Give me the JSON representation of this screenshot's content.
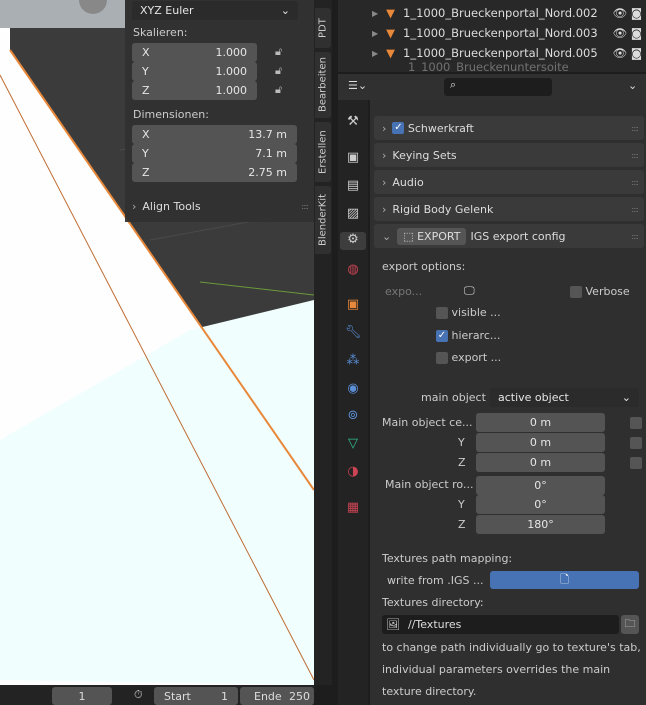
{
  "npanel": {
    "rotation_mode": "XYZ Euler",
    "scale_label": "Skalieren:",
    "scale": [
      {
        "axis": "X",
        "value": "1.000"
      },
      {
        "axis": "Y",
        "value": "1.000"
      },
      {
        "axis": "Z",
        "value": "1.000"
      }
    ],
    "dimensions_label": "Dimensionen:",
    "dimensions": [
      {
        "axis": "X",
        "value": "13.7 m"
      },
      {
        "axis": "Y",
        "value": "7.1 m"
      },
      {
        "axis": "Z",
        "value": "2.75 m"
      }
    ],
    "align_tools": "Align Tools"
  },
  "vtabs": [
    "PDT",
    "Bearbeiten",
    "Erstellen",
    "BlenderKit"
  ],
  "outliner": {
    "items": [
      "1_1000_Brueckenportal_Nord.002",
      "1_1000_Brueckenportal_Nord.003",
      "1_1000_Brueckenportal_Nord.005",
      "1_1000_Brueckenuntersoite"
    ]
  },
  "properties": {
    "panels": {
      "gravity": "Schwerkraft",
      "keying_sets": "Keying Sets",
      "audio": "Audio",
      "rigid_body": "Rigid Body Gelenk",
      "export_btn": "EXPORT",
      "export_title": "IGS export config"
    },
    "export_options_label": "export options:",
    "expo": "expo...",
    "verbose": "Verbose",
    "visible": "visible ...",
    "hierarchy": "hierarc...",
    "export": "export ...",
    "hierarchy_checked": true,
    "verbose_checked": false,
    "main_object_label": "main object",
    "main_object_value": "active object",
    "center_label": "Main object ce...",
    "center": [
      {
        "axis": "",
        "value": "0 m"
      },
      {
        "axis": "Y",
        "value": "0 m"
      },
      {
        "axis": "Z",
        "value": "0 m"
      }
    ],
    "rotation_label": "Main object ro...",
    "rotation": [
      {
        "axis": "",
        "value": "0°"
      },
      {
        "axis": "Y",
        "value": "0°"
      },
      {
        "axis": "Z",
        "value": "180°"
      }
    ],
    "textures_mapping_label": "Textures path mapping:",
    "write_from": "write from  .IGS ...",
    "textures_dir_label": "Textures directory:",
    "textures_dir": "//Textures",
    "note": [
      "to change path individually go to texture's tab,",
      "individual parameters overrides the main",
      "texture directory."
    ]
  },
  "timeline": {
    "current_frame": "1",
    "start_label": "Start",
    "start": "1",
    "end_label": "Ende",
    "end": "250"
  },
  "colors": {
    "accent": "#4772b3",
    "object_orange": "#e8883a"
  }
}
